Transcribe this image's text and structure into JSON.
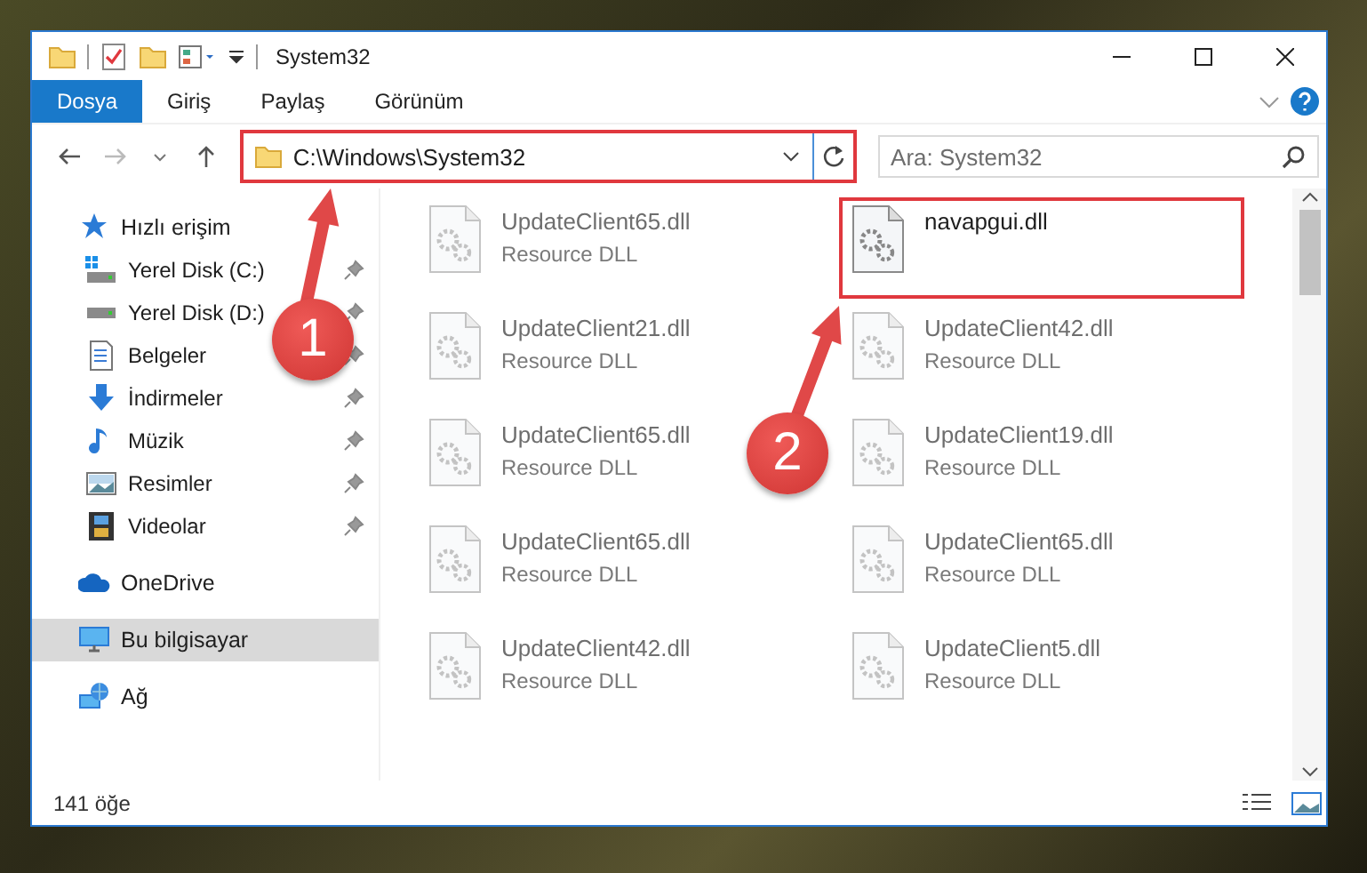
{
  "window": {
    "title": "System32"
  },
  "ribbon_tabs": [
    {
      "label": "Dosya",
      "selected": true
    },
    {
      "label": "Giriş",
      "selected": false
    },
    {
      "label": "Paylaş",
      "selected": false
    },
    {
      "label": "Görünüm",
      "selected": false
    }
  ],
  "address_bar": {
    "value": "C:\\Windows\\System32",
    "highlighted": true
  },
  "search": {
    "placeholder": "Ara: System32"
  },
  "sidebar": {
    "items": [
      {
        "label": "Hızlı erişim",
        "kind": "quick",
        "selected": false,
        "children": [
          {
            "label": "Yerel Disk (C:)",
            "kind": "drive-c",
            "pinned": true,
            "selected": false
          },
          {
            "label": "Yerel Disk (D:)",
            "kind": "drive",
            "pinned": true,
            "selected": false
          },
          {
            "label": "Belgeler",
            "kind": "documents",
            "pinned": true,
            "selected": false
          },
          {
            "label": "İndirmeler",
            "kind": "downloads",
            "pinned": true,
            "selected": false
          },
          {
            "label": "Müzik",
            "kind": "music",
            "pinned": true,
            "selected": false
          },
          {
            "label": "Resimler",
            "kind": "pictures",
            "pinned": true,
            "selected": false
          },
          {
            "label": "Videolar",
            "kind": "videos",
            "pinned": true,
            "selected": false
          }
        ]
      },
      {
        "label": "OneDrive",
        "kind": "cloud",
        "selected": false
      },
      {
        "label": "Bu bilgisayar",
        "kind": "computer",
        "selected": true
      },
      {
        "label": "Ağ",
        "kind": "network",
        "selected": false
      }
    ]
  },
  "files": [
    {
      "name": "UpdateClient65.dll",
      "type": "Resource DLL",
      "blurred": true,
      "highlighted": false
    },
    {
      "name": "navapgui.dll",
      "blurred": false,
      "highlighted": true
    },
    {
      "name": "UpdateClient21.dll",
      "type": "Resource DLL",
      "blurred": true,
      "highlighted": false
    },
    {
      "name": "UpdateClient42.dll",
      "type": "Resource DLL",
      "blurred": true,
      "highlighted": false
    },
    {
      "name": "UpdateClient65.dll",
      "type": "Resource DLL",
      "blurred": true,
      "highlighted": false
    },
    {
      "name": "UpdateClient19.dll",
      "type": "Resource DLL",
      "blurred": true,
      "highlighted": false
    },
    {
      "name": "UpdateClient65.dll",
      "type": "Resource DLL",
      "blurred": true,
      "highlighted": false
    },
    {
      "name": "UpdateClient65.dll",
      "type": "Resource DLL",
      "blurred": true,
      "highlighted": false
    },
    {
      "name": "UpdateClient42.dll",
      "type": "Resource DLL",
      "blurred": true,
      "highlighted": false
    },
    {
      "name": "UpdateClient5.dll",
      "type": "Resource DLL",
      "blurred": true,
      "highlighted": false
    }
  ],
  "status_bar": {
    "item_count": "141 öğe"
  },
  "callouts": [
    {
      "label": "1"
    },
    {
      "label": "2"
    }
  ]
}
